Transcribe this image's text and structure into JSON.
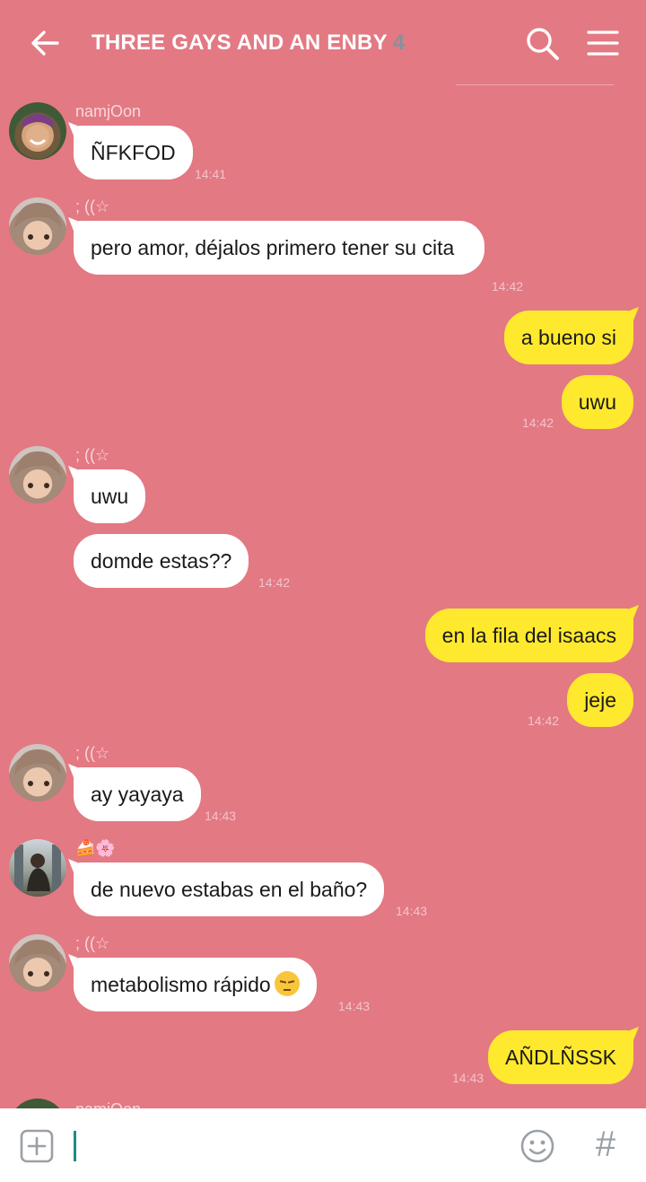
{
  "header": {
    "title": "THREE GAYS AND AN ENBY",
    "member_count": "4"
  },
  "messages": [
    {
      "sender": "namjOon",
      "text": "ÑFKFOD",
      "time": "14:41",
      "direction": "in"
    },
    {
      "sender": "; ((☆",
      "text": "pero amor, déjalos primero tener su cita",
      "time": "14:42",
      "direction": "in"
    },
    {
      "text": "a bueno si",
      "direction": "out"
    },
    {
      "text": "uwu",
      "time": "14:42",
      "direction": "out"
    },
    {
      "sender": "; ((☆",
      "text": "uwu",
      "direction": "in"
    },
    {
      "text": "domde estas??",
      "time": "14:42",
      "direction": "in"
    },
    {
      "text": "en la fila del isaacs",
      "direction": "out"
    },
    {
      "text": "jeje",
      "time": "14:42",
      "direction": "out"
    },
    {
      "sender": "; ((☆",
      "text": "ay yayaya",
      "time": "14:43",
      "direction": "in"
    },
    {
      "sender": "🍰🌸",
      "text": "de nuevo estabas en el baño?",
      "time": "14:43",
      "direction": "in"
    },
    {
      "sender": "; ((☆",
      "text": "metabolismo rápido",
      "time": "14:43",
      "direction": "in",
      "emoji": "pensive-face"
    },
    {
      "text": "AÑDLÑSSK",
      "time": "14:43",
      "direction": "out"
    },
    {
      "sender": "namjOon",
      "direction": "in",
      "partial": true
    }
  ],
  "input": {
    "placeholder": "",
    "value": ""
  },
  "icons": {
    "back": "arrow-left-icon",
    "search": "search-icon",
    "menu": "hamburger-menu-icon",
    "add": "plus-square-icon",
    "sticker": "smiley-icon",
    "hashtag": "#"
  },
  "colors": {
    "background": "#e37983",
    "incoming_bubble": "#ffffff",
    "outgoing_bubble": "#fee92e",
    "caret": "#1b8d87"
  }
}
